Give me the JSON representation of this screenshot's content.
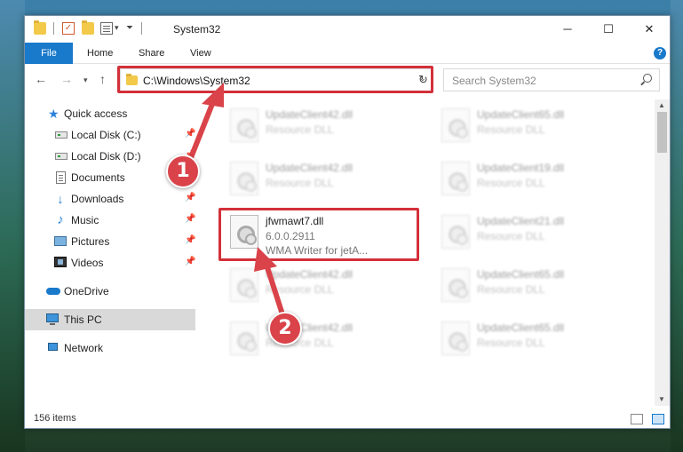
{
  "window": {
    "title": "System32",
    "minimize": "─",
    "maximize": "☐",
    "close": "✕"
  },
  "ribbon": {
    "file": "File",
    "home": "Home",
    "share": "Share",
    "view": "View",
    "help": "?"
  },
  "address": {
    "path": "C:\\Windows\\System32",
    "search_placeholder": "Search System32"
  },
  "sidebar": {
    "items": [
      {
        "label": "Quick access"
      },
      {
        "label": "Local Disk (C:)"
      },
      {
        "label": "Local Disk (D:)"
      },
      {
        "label": "Documents"
      },
      {
        "label": "Downloads"
      },
      {
        "label": "Music"
      },
      {
        "label": "Pictures"
      },
      {
        "label": "Videos"
      },
      {
        "label": "OneDrive"
      },
      {
        "label": "This PC"
      },
      {
        "label": "Network"
      }
    ]
  },
  "files": [
    {
      "name": "UpdateClient42.dll",
      "sub": "Resource DLL"
    },
    {
      "name": "UpdateClient65.dll",
      "sub": "Resource DLL"
    },
    {
      "name": "UpdateClient42.dll",
      "sub": "Resource DLL"
    },
    {
      "name": "UpdateClient19.dll",
      "sub": "Resource DLL"
    },
    {
      "name": "jfwmawt7.dll",
      "sub": "6.0.0.2911",
      "sub2": "WMA Writer for jetA..."
    },
    {
      "name": "UpdateClient21.dll",
      "sub": "Resource DLL"
    },
    {
      "name": "UpdateClient42.dll",
      "sub": "Resource DLL"
    },
    {
      "name": "UpdateClient65.dll",
      "sub": "Resource DLL"
    },
    {
      "name": "UpdateClient42.dll",
      "sub": "Resource DLL"
    },
    {
      "name": "UpdateClient65.dll",
      "sub": "Resource DLL"
    }
  ],
  "status": {
    "count": "156 items"
  },
  "markers": {
    "one": "1",
    "two": "2"
  },
  "colors": {
    "accent": "#1979ca",
    "highlight": "#d3303a"
  }
}
